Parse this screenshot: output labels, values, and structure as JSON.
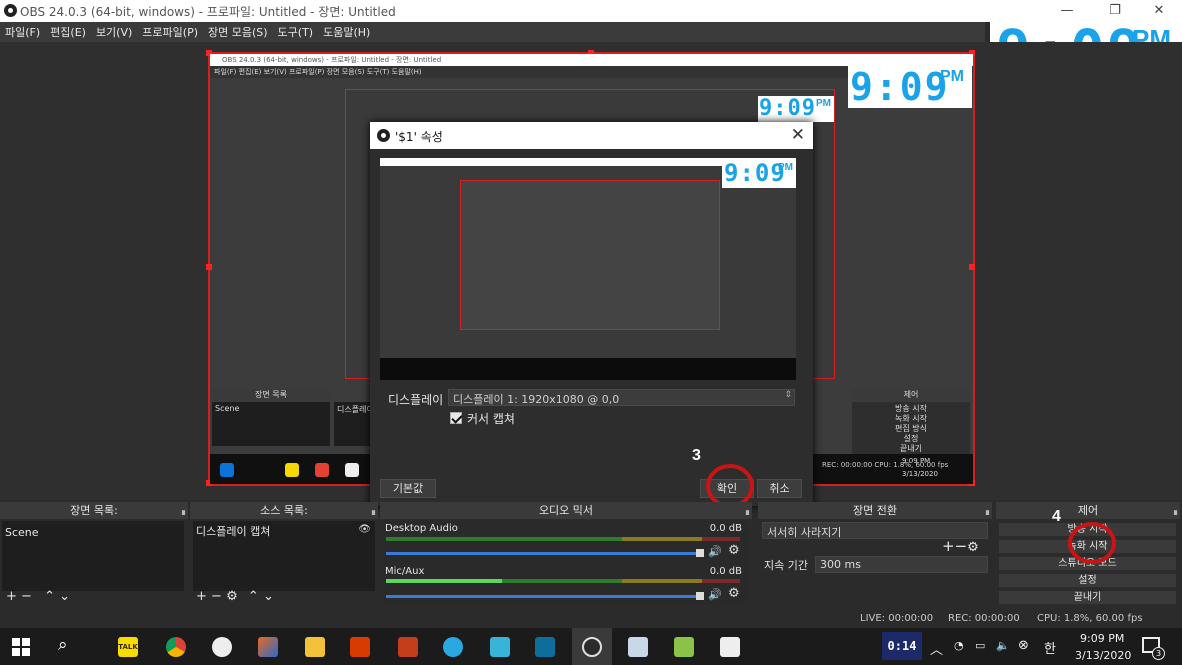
{
  "window": {
    "title": "OBS 24.0.3 (64-bit, windows) - 프로파일: Untitled - 장면: Untitled",
    "min": "—",
    "max": "❐",
    "close": "✕"
  },
  "menu": [
    "파일(F)",
    "편집(E)",
    "보기(V)",
    "프로파일(P)",
    "장면 모음(S)",
    "도구(T)",
    "도움말(H)"
  ],
  "clock": {
    "time": "9:09",
    "ampm": "PM"
  },
  "dialog": {
    "title": "'$1' 속성",
    "display_label": "디스플레이",
    "display_value": "디스플레이 1: 1920x1080 @ 0,0",
    "cursor_label": "커서 캡쳐",
    "default_button": "기본값",
    "ok_button": "확인",
    "cancel_button": "취소"
  },
  "annotations": {
    "step3": "3",
    "step4": "4"
  },
  "docks": {
    "scenes": {
      "title": "장면 목록:",
      "items": [
        "Scene"
      ]
    },
    "sources": {
      "title": "소스 목록:",
      "items": [
        "디스플레이 캡쳐"
      ]
    },
    "mixer": {
      "title": "오디오 믹서",
      "tracks": [
        {
          "name": "Desktop Audio",
          "db": "0.0 dB"
        },
        {
          "name": "Mic/Aux",
          "db": "0.0 dB"
        }
      ]
    },
    "transitions": {
      "title": "장면 전환",
      "value": "서서히 사라지기",
      "duration_label": "지속 기간",
      "duration_value": "300 ms"
    },
    "controls": {
      "title": "제어",
      "buttons": [
        "방송 시작",
        "녹화 시작",
        "스튜디오 모드",
        "설정",
        "끝내기"
      ]
    }
  },
  "status": {
    "live": "LIVE: 00:00:00",
    "rec": "REC: 00:00:00",
    "cpu": "CPU: 1.8%, 60.00 fps"
  },
  "taskbar": {
    "time": "9:09 PM",
    "date": "3/13/2020",
    "timer": "0:14",
    "ime": "한",
    "notifications": "3",
    "talk": "TALK"
  },
  "nested": {
    "title": "OBS 24.0.3 (64-bit, windows) - 프로파일: Untitled - 장면: Untitled",
    "menu": "파일(F)  편집(E)  보기(V)  프로파일(P)  장면 모음(S)  도구(T)  도움말(H)",
    "scenes": "장면 목록",
    "scene": "Scene",
    "source": "디스플레이",
    "control": "제어",
    "ctrl_items": [
      "방송 시작",
      "녹화 시작",
      "편집 방식",
      "설정",
      "끝내기"
    ],
    "status": "REC: 00:00:00    CPU: 1.8%, 60.00 fps",
    "time": "9:09 PM",
    "date": "3/13/2020"
  },
  "colors": {
    "accent": "#1aa3e8",
    "selection_red": "#d32020",
    "annotation_red": "#c81414"
  }
}
